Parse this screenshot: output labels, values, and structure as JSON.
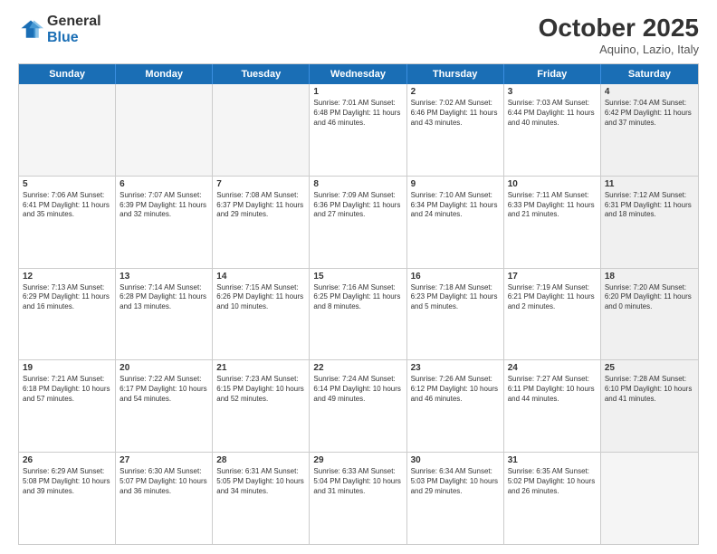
{
  "logo": {
    "general": "General",
    "blue": "Blue"
  },
  "title": "October 2025",
  "subtitle": "Aquino, Lazio, Italy",
  "days": [
    "Sunday",
    "Monday",
    "Tuesday",
    "Wednesday",
    "Thursday",
    "Friday",
    "Saturday"
  ],
  "rows": [
    [
      {
        "day": "",
        "text": "",
        "empty": true
      },
      {
        "day": "",
        "text": "",
        "empty": true
      },
      {
        "day": "",
        "text": "",
        "empty": true
      },
      {
        "day": "1",
        "text": "Sunrise: 7:01 AM\nSunset: 6:48 PM\nDaylight: 11 hours and 46 minutes.",
        "empty": false
      },
      {
        "day": "2",
        "text": "Sunrise: 7:02 AM\nSunset: 6:46 PM\nDaylight: 11 hours and 43 minutes.",
        "empty": false
      },
      {
        "day": "3",
        "text": "Sunrise: 7:03 AM\nSunset: 6:44 PM\nDaylight: 11 hours and 40 minutes.",
        "empty": false
      },
      {
        "day": "4",
        "text": "Sunrise: 7:04 AM\nSunset: 6:42 PM\nDaylight: 11 hours and 37 minutes.",
        "empty": false,
        "shaded": true
      }
    ],
    [
      {
        "day": "5",
        "text": "Sunrise: 7:06 AM\nSunset: 6:41 PM\nDaylight: 11 hours and 35 minutes.",
        "empty": false
      },
      {
        "day": "6",
        "text": "Sunrise: 7:07 AM\nSunset: 6:39 PM\nDaylight: 11 hours and 32 minutes.",
        "empty": false
      },
      {
        "day": "7",
        "text": "Sunrise: 7:08 AM\nSunset: 6:37 PM\nDaylight: 11 hours and 29 minutes.",
        "empty": false
      },
      {
        "day": "8",
        "text": "Sunrise: 7:09 AM\nSunset: 6:36 PM\nDaylight: 11 hours and 27 minutes.",
        "empty": false
      },
      {
        "day": "9",
        "text": "Sunrise: 7:10 AM\nSunset: 6:34 PM\nDaylight: 11 hours and 24 minutes.",
        "empty": false
      },
      {
        "day": "10",
        "text": "Sunrise: 7:11 AM\nSunset: 6:33 PM\nDaylight: 11 hours and 21 minutes.",
        "empty": false
      },
      {
        "day": "11",
        "text": "Sunrise: 7:12 AM\nSunset: 6:31 PM\nDaylight: 11 hours and 18 minutes.",
        "empty": false,
        "shaded": true
      }
    ],
    [
      {
        "day": "12",
        "text": "Sunrise: 7:13 AM\nSunset: 6:29 PM\nDaylight: 11 hours and 16 minutes.",
        "empty": false
      },
      {
        "day": "13",
        "text": "Sunrise: 7:14 AM\nSunset: 6:28 PM\nDaylight: 11 hours and 13 minutes.",
        "empty": false
      },
      {
        "day": "14",
        "text": "Sunrise: 7:15 AM\nSunset: 6:26 PM\nDaylight: 11 hours and 10 minutes.",
        "empty": false
      },
      {
        "day": "15",
        "text": "Sunrise: 7:16 AM\nSunset: 6:25 PM\nDaylight: 11 hours and 8 minutes.",
        "empty": false
      },
      {
        "day": "16",
        "text": "Sunrise: 7:18 AM\nSunset: 6:23 PM\nDaylight: 11 hours and 5 minutes.",
        "empty": false
      },
      {
        "day": "17",
        "text": "Sunrise: 7:19 AM\nSunset: 6:21 PM\nDaylight: 11 hours and 2 minutes.",
        "empty": false
      },
      {
        "day": "18",
        "text": "Sunrise: 7:20 AM\nSunset: 6:20 PM\nDaylight: 11 hours and 0 minutes.",
        "empty": false,
        "shaded": true
      }
    ],
    [
      {
        "day": "19",
        "text": "Sunrise: 7:21 AM\nSunset: 6:18 PM\nDaylight: 10 hours and 57 minutes.",
        "empty": false
      },
      {
        "day": "20",
        "text": "Sunrise: 7:22 AM\nSunset: 6:17 PM\nDaylight: 10 hours and 54 minutes.",
        "empty": false
      },
      {
        "day": "21",
        "text": "Sunrise: 7:23 AM\nSunset: 6:15 PM\nDaylight: 10 hours and 52 minutes.",
        "empty": false
      },
      {
        "day": "22",
        "text": "Sunrise: 7:24 AM\nSunset: 6:14 PM\nDaylight: 10 hours and 49 minutes.",
        "empty": false
      },
      {
        "day": "23",
        "text": "Sunrise: 7:26 AM\nSunset: 6:12 PM\nDaylight: 10 hours and 46 minutes.",
        "empty": false
      },
      {
        "day": "24",
        "text": "Sunrise: 7:27 AM\nSunset: 6:11 PM\nDaylight: 10 hours and 44 minutes.",
        "empty": false
      },
      {
        "day": "25",
        "text": "Sunrise: 7:28 AM\nSunset: 6:10 PM\nDaylight: 10 hours and 41 minutes.",
        "empty": false,
        "shaded": true
      }
    ],
    [
      {
        "day": "26",
        "text": "Sunrise: 6:29 AM\nSunset: 5:08 PM\nDaylight: 10 hours and 39 minutes.",
        "empty": false
      },
      {
        "day": "27",
        "text": "Sunrise: 6:30 AM\nSunset: 5:07 PM\nDaylight: 10 hours and 36 minutes.",
        "empty": false
      },
      {
        "day": "28",
        "text": "Sunrise: 6:31 AM\nSunset: 5:05 PM\nDaylight: 10 hours and 34 minutes.",
        "empty": false
      },
      {
        "day": "29",
        "text": "Sunrise: 6:33 AM\nSunset: 5:04 PM\nDaylight: 10 hours and 31 minutes.",
        "empty": false
      },
      {
        "day": "30",
        "text": "Sunrise: 6:34 AM\nSunset: 5:03 PM\nDaylight: 10 hours and 29 minutes.",
        "empty": false
      },
      {
        "day": "31",
        "text": "Sunrise: 6:35 AM\nSunset: 5:02 PM\nDaylight: 10 hours and 26 minutes.",
        "empty": false
      },
      {
        "day": "",
        "text": "",
        "empty": true,
        "shaded": true
      }
    ]
  ]
}
